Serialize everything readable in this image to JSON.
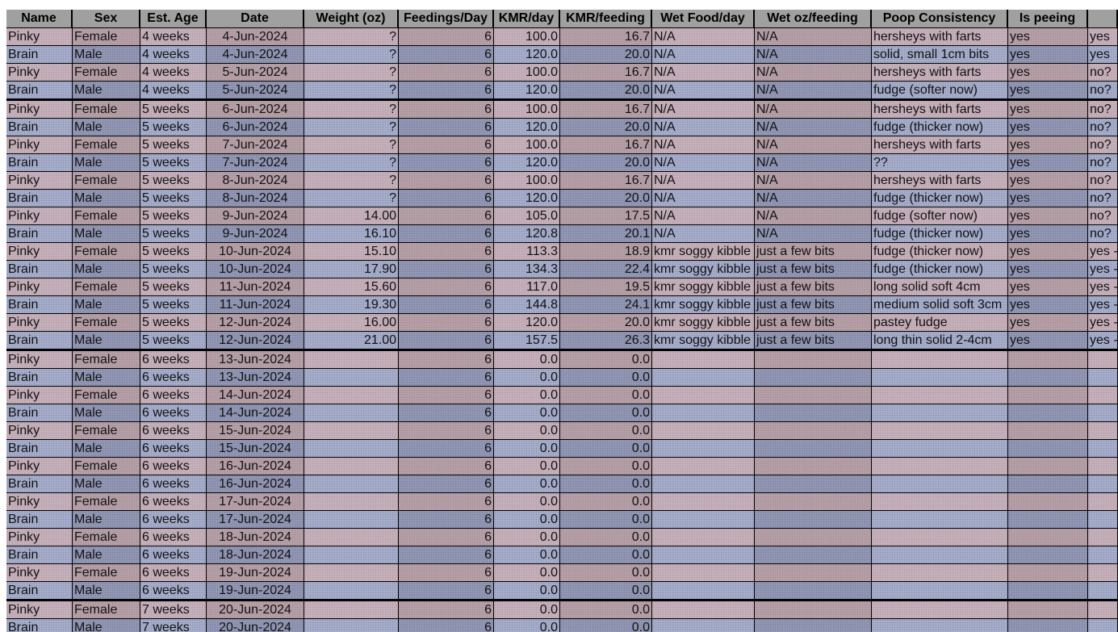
{
  "columns": [
    "Name",
    "Sex",
    "Est. Age",
    "Date",
    "Weight (oz)",
    "Feedings/Day",
    "KMR/day",
    "KMR/feeding",
    "Wet Food/day",
    "Wet oz/feeding",
    "Poop Consistency",
    "Is peeing",
    ""
  ],
  "rows": [
    [
      "Pinky",
      "Female",
      "4 weeks",
      "4-Jun-2024",
      "?",
      "6",
      "100.0",
      "16.7",
      "N/A",
      "N/A",
      "hersheys with farts",
      "yes",
      "yes"
    ],
    [
      "Brain",
      "Male",
      "4 weeks",
      "4-Jun-2024",
      "?",
      "6",
      "120.0",
      "20.0",
      "N/A",
      "N/A",
      "solid, small 1cm bits",
      "yes",
      "yes"
    ],
    [
      "Pinky",
      "Female",
      "4 weeks",
      "5-Jun-2024",
      "?",
      "6",
      "100.0",
      "16.7",
      "N/A",
      "N/A",
      "hersheys with farts",
      "yes",
      "no?"
    ],
    [
      "Brain",
      "Male",
      "4 weeks",
      "5-Jun-2024",
      "?",
      "6",
      "120.0",
      "20.0",
      "N/A",
      "N/A",
      "fudge (softer now)",
      "yes",
      "no?"
    ],
    [
      "Pinky",
      "Female",
      "5 weeks",
      "6-Jun-2024",
      "?",
      "6",
      "100.0",
      "16.7",
      "N/A",
      "N/A",
      "hersheys with farts",
      "yes",
      "no?"
    ],
    [
      "Brain",
      "Male",
      "5 weeks",
      "6-Jun-2024",
      "?",
      "6",
      "120.0",
      "20.0",
      "N/A",
      "N/A",
      "fudge (thicker now)",
      "yes",
      "no?"
    ],
    [
      "Pinky",
      "Female",
      "5 weeks",
      "7-Jun-2024",
      "?",
      "6",
      "100.0",
      "16.7",
      "N/A",
      "N/A",
      "hersheys with farts",
      "yes",
      "no?"
    ],
    [
      "Brain",
      "Male",
      "5 weeks",
      "7-Jun-2024",
      "?",
      "6",
      "120.0",
      "20.0",
      "N/A",
      "N/A",
      "??",
      "yes",
      "no?"
    ],
    [
      "Pinky",
      "Female",
      "5 weeks",
      "8-Jun-2024",
      "?",
      "6",
      "100.0",
      "16.7",
      "N/A",
      "N/A",
      "hersheys with farts",
      "yes",
      "no?"
    ],
    [
      "Brain",
      "Male",
      "5 weeks",
      "8-Jun-2024",
      "?",
      "6",
      "120.0",
      "20.0",
      "N/A",
      "N/A",
      "fudge (thicker now)",
      "yes",
      "no?"
    ],
    [
      "Pinky",
      "Female",
      "5 weeks",
      "9-Jun-2024",
      "14.00",
      "6",
      "105.0",
      "17.5",
      "N/A",
      "N/A",
      "fudge (softer now)",
      "yes",
      "no?"
    ],
    [
      "Brain",
      "Male",
      "5 weeks",
      "9-Jun-2024",
      "16.10",
      "6",
      "120.8",
      "20.1",
      "N/A",
      "N/A",
      "fudge (thicker now)",
      "yes",
      "no?"
    ],
    [
      "Pinky",
      "Female",
      "5 weeks",
      "10-Jun-2024",
      "15.10",
      "6",
      "113.3",
      "18.9",
      "kmr soggy kibble",
      "just a few bits",
      "fudge (thicker now)",
      "yes",
      "yes -"
    ],
    [
      "Brain",
      "Male",
      "5 weeks",
      "10-Jun-2024",
      "17.90",
      "6",
      "134.3",
      "22.4",
      "kmr soggy kibble",
      "just a few bits",
      "fudge (thicker now)",
      "yes",
      "yes -"
    ],
    [
      "Pinky",
      "Female",
      "5 weeks",
      "11-Jun-2024",
      "15.60",
      "6",
      "117.0",
      "19.5",
      "kmr soggy kibble",
      "just a few bits",
      "long solid soft 4cm",
      "yes",
      "yes -"
    ],
    [
      "Brain",
      "Male",
      "5 weeks",
      "11-Jun-2024",
      "19.30",
      "6",
      "144.8",
      "24.1",
      "kmr soggy kibble",
      "just a few bits",
      "medium solid soft 3cm",
      "yes",
      "yes -"
    ],
    [
      "Pinky",
      "Female",
      "5 weeks",
      "12-Jun-2024",
      "16.00",
      "6",
      "120.0",
      "20.0",
      "kmr soggy kibble",
      "just a few bits",
      "pastey fudge",
      "yes",
      "yes -"
    ],
    [
      "Brain",
      "Male",
      "5 weeks",
      "12-Jun-2024",
      "21.00",
      "6",
      "157.5",
      "26.3",
      "kmr soggy kibble",
      "just a few bits",
      "long thin solid 2-4cm",
      "yes",
      "yes -"
    ],
    [
      "Pinky",
      "Female",
      "6 weeks",
      "13-Jun-2024",
      "",
      "6",
      "0.0",
      "0.0",
      "",
      "",
      "",
      "",
      ""
    ],
    [
      "Brain",
      "Male",
      "6 weeks",
      "13-Jun-2024",
      "",
      "6",
      "0.0",
      "0.0",
      "",
      "",
      "",
      "",
      ""
    ],
    [
      "Pinky",
      "Female",
      "6 weeks",
      "14-Jun-2024",
      "",
      "6",
      "0.0",
      "0.0",
      "",
      "",
      "",
      "",
      ""
    ],
    [
      "Brain",
      "Male",
      "6 weeks",
      "14-Jun-2024",
      "",
      "6",
      "0.0",
      "0.0",
      "",
      "",
      "",
      "",
      ""
    ],
    [
      "Pinky",
      "Female",
      "6 weeks",
      "15-Jun-2024",
      "",
      "6",
      "0.0",
      "0.0",
      "",
      "",
      "",
      "",
      ""
    ],
    [
      "Brain",
      "Male",
      "6 weeks",
      "15-Jun-2024",
      "",
      "6",
      "0.0",
      "0.0",
      "",
      "",
      "",
      "",
      ""
    ],
    [
      "Pinky",
      "Female",
      "6 weeks",
      "16-Jun-2024",
      "",
      "6",
      "0.0",
      "0.0",
      "",
      "",
      "",
      "",
      ""
    ],
    [
      "Brain",
      "Male",
      "6 weeks",
      "16-Jun-2024",
      "",
      "6",
      "0.0",
      "0.0",
      "",
      "",
      "",
      "",
      ""
    ],
    [
      "Pinky",
      "Female",
      "6 weeks",
      "17-Jun-2024",
      "",
      "6",
      "0.0",
      "0.0",
      "",
      "",
      "",
      "",
      ""
    ],
    [
      "Brain",
      "Male",
      "6 weeks",
      "17-Jun-2024",
      "",
      "6",
      "0.0",
      "0.0",
      "",
      "",
      "",
      "",
      ""
    ],
    [
      "Pinky",
      "Female",
      "6 weeks",
      "18-Jun-2024",
      "",
      "6",
      "0.0",
      "0.0",
      "",
      "",
      "",
      "",
      ""
    ],
    [
      "Brain",
      "Male",
      "6 weeks",
      "18-Jun-2024",
      "",
      "6",
      "0.0",
      "0.0",
      "",
      "",
      "",
      "",
      ""
    ],
    [
      "Pinky",
      "Female",
      "6 weeks",
      "19-Jun-2024",
      "",
      "6",
      "0.0",
      "0.0",
      "",
      "",
      "",
      "",
      ""
    ],
    [
      "Brain",
      "Male",
      "6 weeks",
      "19-Jun-2024",
      "",
      "6",
      "0.0",
      "0.0",
      "",
      "",
      "",
      "",
      ""
    ],
    [
      "Pinky",
      "Female",
      "7 weeks",
      "20-Jun-2024",
      "",
      "6",
      "0.0",
      "0.0",
      "",
      "",
      "",
      "",
      ""
    ],
    [
      "Brain",
      "Male",
      "7 weeks",
      "20-Jun-2024",
      "",
      "6",
      "0.0",
      "0.0",
      "",
      "",
      "",
      "",
      ""
    ]
  ]
}
